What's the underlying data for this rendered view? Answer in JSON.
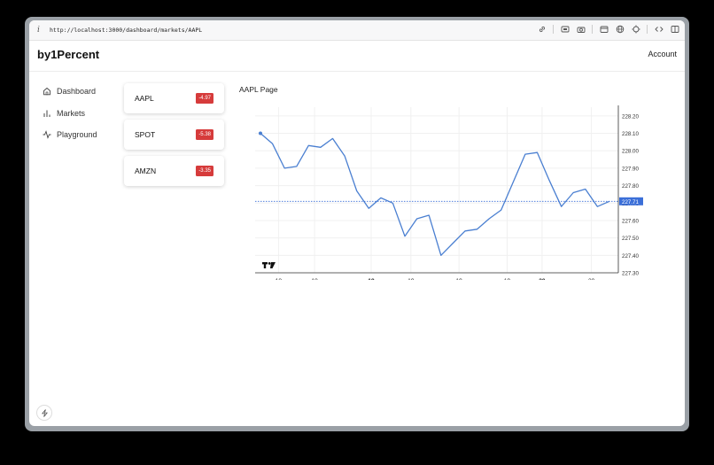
{
  "browser": {
    "url": "http://localhost:3000/dashboard/markets/AAPL",
    "icons": [
      "info-icon",
      "link-icon",
      "screenshot-icon",
      "camera-icon",
      "window-icon",
      "globe-icon",
      "target-icon",
      "devtools-icon",
      "sidebar-icon"
    ]
  },
  "app": {
    "brand": "by1Percent",
    "account": "Account"
  },
  "nav": {
    "items": [
      {
        "label": "Dashboard",
        "icon": "home-icon"
      },
      {
        "label": "Markets",
        "icon": "bar-chart-icon"
      },
      {
        "label": "Playground",
        "icon": "activity-icon"
      }
    ]
  },
  "tickers": [
    {
      "symbol": "AAPL",
      "change": "-4.97"
    },
    {
      "symbol": "SPOT",
      "change": "-5.38"
    },
    {
      "symbol": "AMZN",
      "change": "-3.35"
    }
  ],
  "page": {
    "title": "AAPL Page"
  },
  "chart_data": {
    "type": "line",
    "title": "",
    "xlabel": "",
    "ylabel": "",
    "x_ticks": [
      {
        "label": "18",
        "bold": false,
        "index": 1.5
      },
      {
        "label": "18",
        "bold": false,
        "index": 4.5
      },
      {
        "label": "19",
        "bold": true,
        "index": 9.2
      },
      {
        "label": "19",
        "bold": false,
        "index": 12.5
      },
      {
        "label": "19",
        "bold": false,
        "index": 16.5
      },
      {
        "label": "19",
        "bold": false,
        "index": 20.5
      },
      {
        "label": "20",
        "bold": true,
        "index": 23.4
      },
      {
        "label": "20",
        "bold": false,
        "index": 27.5
      }
    ],
    "y_ticks": [
      "228.20",
      "228.10",
      "228.00",
      "227.90",
      "227.80",
      "227.70",
      "227.60",
      "227.50",
      "227.40",
      "227.30"
    ],
    "ylim": [
      227.3,
      228.25
    ],
    "values": [
      228.1,
      228.04,
      227.9,
      227.91,
      228.03,
      228.02,
      228.07,
      227.97,
      227.77,
      227.67,
      227.73,
      227.7,
      227.51,
      227.61,
      227.63,
      227.4,
      227.47,
      227.54,
      227.55,
      227.61,
      227.66,
      227.82,
      227.98,
      227.99,
      227.83,
      227.68,
      227.76,
      227.78,
      227.68,
      227.71
    ],
    "last_price": "227.71",
    "colors": {
      "line": "#4a7fd1",
      "price_label": "#3b6fd8",
      "grid": "#f0f0f0"
    },
    "watermark": "TV"
  }
}
